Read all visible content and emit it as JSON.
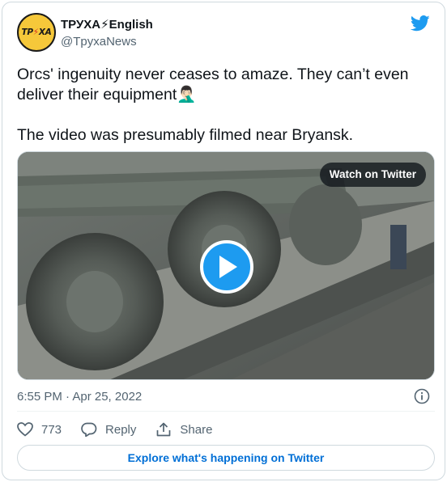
{
  "author": {
    "avatar_text": "ТРУХА",
    "display_name": "ТРУХА⚡English",
    "handle": "@TpyxaNews"
  },
  "tweet": {
    "text": "Orcs' ingenuity never ceases to amaze. They can’t even deliver their equipment🤦🏻‍♂️\n\nThe video was presumably filmed near Bryansk."
  },
  "media": {
    "watch_label": "Watch on Twitter"
  },
  "meta": {
    "timestamp": "6:55 PM · Apr 25, 2022"
  },
  "actions": {
    "like_count": "773",
    "reply_label": "Reply",
    "share_label": "Share"
  },
  "footer": {
    "explore_label": "Explore what's happening on Twitter"
  },
  "colors": {
    "twitter_blue": "#1d9bf0",
    "link_blue": "#006fd6",
    "muted": "#536471"
  }
}
